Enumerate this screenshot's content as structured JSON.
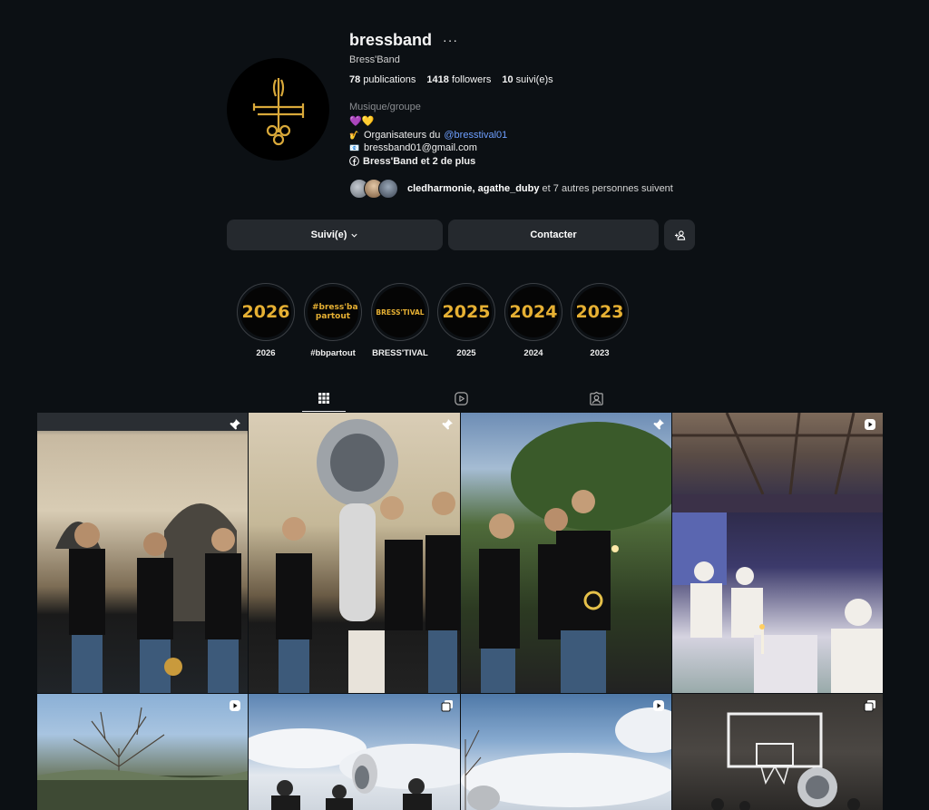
{
  "profile": {
    "username": "bressband",
    "more_icon": "more-horizontal-icon",
    "full_name": "Bress'Band",
    "stats": {
      "publications_count": "78",
      "publications_label": "publications",
      "followers_count": "1418",
      "followers_label": "followers",
      "following_count": "10",
      "following_label": "suivi(e)s"
    },
    "category": "Musique/groupe",
    "bio": {
      "hearts": "💜💛",
      "organizers_prefix": "Organisateurs du",
      "organizers_mention": "@bresstival01",
      "email": "bressband01@gmail.com",
      "links": "Bress'Band et 2 de plus"
    },
    "followed_by": {
      "names": "cledharmonie, agathe_duby",
      "suffix": "et 7 autres personnes suivent"
    }
  },
  "actions": {
    "follow_label": "Suivi(e)",
    "contact_label": "Contacter",
    "add_user_icon": "add-user-icon"
  },
  "highlights": [
    {
      "label": "2026",
      "cover_text": "2026"
    },
    {
      "label": "#bbpartout",
      "cover_text": "#bress'band partout"
    },
    {
      "label": "BRESS'TIVAL",
      "cover_text": "BRESS'TIVAL"
    },
    {
      "label": "2025",
      "cover_text": "2025"
    },
    {
      "label": "2024",
      "cover_text": "2024"
    },
    {
      "label": "2023",
      "cover_text": "2023"
    }
  ],
  "tabs": [
    {
      "name": "posts",
      "icon": "grid-icon",
      "active": true
    },
    {
      "name": "reels",
      "icon": "reels-icon",
      "active": false
    },
    {
      "name": "tagged",
      "icon": "tagged-icon",
      "active": false
    }
  ],
  "posts": [
    {
      "description": "band photo part 1",
      "badge": "pin-icon"
    },
    {
      "description": "band photo part 2",
      "badge": "pin-icon"
    },
    {
      "description": "band photo part 3",
      "badge": "pin-icon"
    },
    {
      "description": "dinner party",
      "badge": "reel-icon"
    },
    {
      "description": "outdoor trees",
      "badge": "reel-icon"
    },
    {
      "description": "tuba players",
      "badge": "carousel-icon"
    },
    {
      "description": "clouds",
      "badge": "reel-icon"
    },
    {
      "description": "basketball gym",
      "badge": "carousel-icon"
    }
  ],
  "colors": {
    "background": "#0c1014",
    "button": "#25292e",
    "link": "#6e9fff",
    "gold": "#e6b033"
  }
}
